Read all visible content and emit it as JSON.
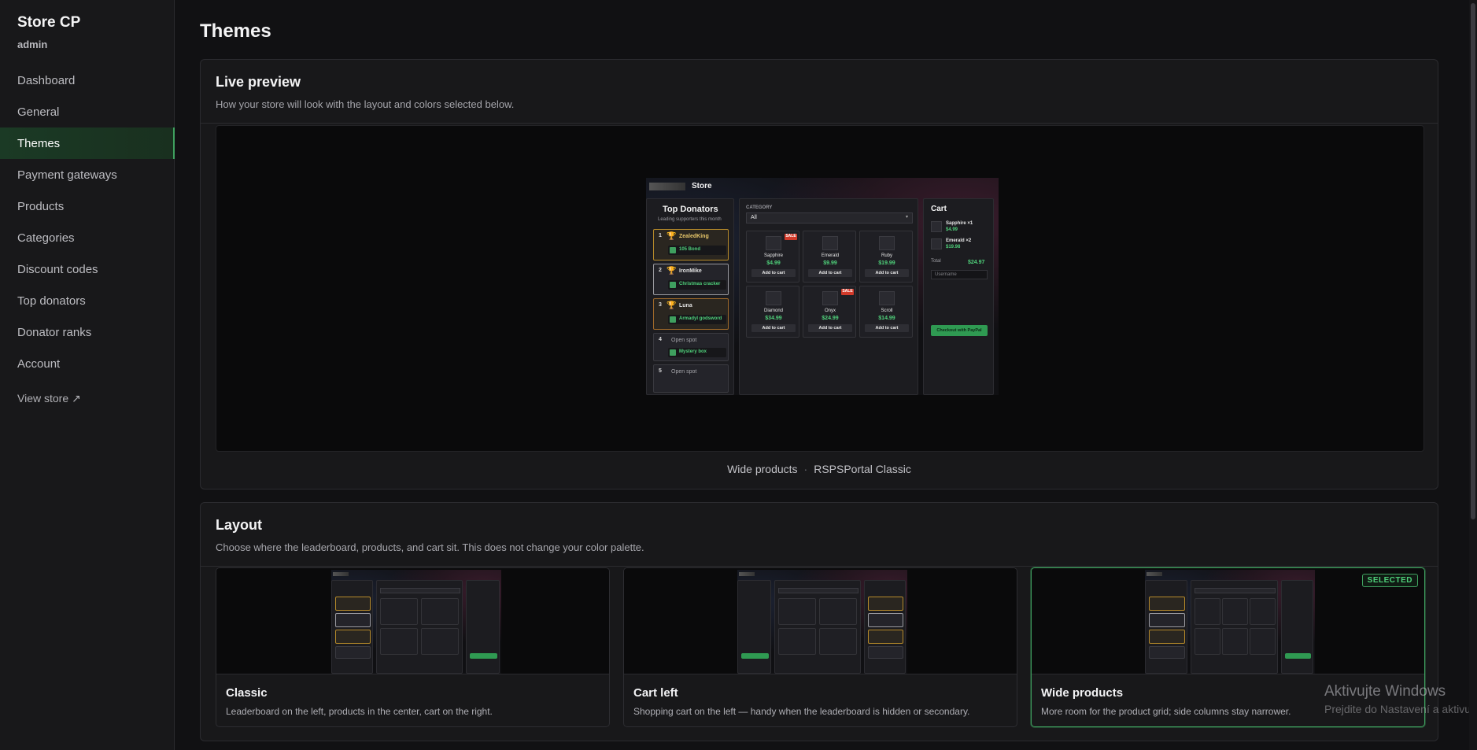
{
  "sidebar": {
    "brand": "Store CP",
    "user": "admin",
    "items": [
      {
        "label": "Dashboard"
      },
      {
        "label": "General"
      },
      {
        "label": "Themes"
      },
      {
        "label": "Payment gateways"
      },
      {
        "label": "Products"
      },
      {
        "label": "Categories"
      },
      {
        "label": "Discount codes"
      },
      {
        "label": "Top donators"
      },
      {
        "label": "Donator ranks"
      },
      {
        "label": "Account"
      }
    ],
    "active_index": 2,
    "view_store": "View store ↗"
  },
  "page": {
    "title": "Themes"
  },
  "preview": {
    "title": "Live preview",
    "description": "How your store will look with the layout and colors selected below.",
    "caption_layout": "Wide products",
    "caption_sep": "·",
    "caption_palette": "RSPSPortal Classic"
  },
  "mock": {
    "store_name": "Store",
    "donators_title": "Top Donators",
    "donators_sub": "Leading supporters this month",
    "donators": [
      {
        "rank": "1",
        "name": "ZealedKing",
        "item": "105 Bond"
      },
      {
        "rank": "2",
        "name": "IronMike",
        "item": "Christmas cracker"
      },
      {
        "rank": "3",
        "name": "Luna",
        "item": "Armadyl godsword"
      },
      {
        "rank": "4",
        "name": "Open spot",
        "item": "Mystery box"
      },
      {
        "rank": "5",
        "name": "Open spot",
        "item": ""
      }
    ],
    "category_label": "CATEGORY",
    "category_value": "All",
    "products": [
      {
        "name": "Sapphire",
        "price": "$4.99",
        "sale": true
      },
      {
        "name": "Emerald",
        "price": "$9.99",
        "sale": false
      },
      {
        "name": "Ruby",
        "price": "$19.99",
        "sale": false
      },
      {
        "name": "Diamond",
        "price": "$34.99",
        "sale": false
      },
      {
        "name": "Onyx",
        "price": "$24.99",
        "sale": true
      },
      {
        "name": "Scroll",
        "price": "$14.99",
        "sale": false
      }
    ],
    "sale_label": "SALE",
    "add_to_cart": "Add to cart",
    "cart_title": "Cart",
    "cart_items": [
      {
        "name": "Sapphire ×1",
        "price": "$4.99"
      },
      {
        "name": "Emerald ×2",
        "price": "$19.98"
      }
    ],
    "total_label": "Total",
    "total_value": "$24.97",
    "username_placeholder": "Username",
    "checkout": "Checkout with PayPal"
  },
  "layout": {
    "title": "Layout",
    "description": "Choose where the leaderboard, products, and cart sit. This does not change your color palette.",
    "selected_badge": "SELECTED",
    "options": [
      {
        "title": "Classic",
        "desc": "Leaderboard on the left, products in the center, cart on the right."
      },
      {
        "title": "Cart left",
        "desc": "Shopping cart on the left — handy when the leaderboard is hidden or secondary."
      },
      {
        "title": "Wide products",
        "desc": "More room for the product grid; side columns stay narrower."
      }
    ],
    "selected_index": 2
  },
  "watermark": {
    "line1": "Aktivujte Windows",
    "line2": "Prejdite do Nastavení a aktivujte systém Windows."
  },
  "colors": {
    "accent": "#3fa05f",
    "price_green": "#4fd07a",
    "sale_red": "#d23a2a",
    "gold": "#e0b33b"
  }
}
